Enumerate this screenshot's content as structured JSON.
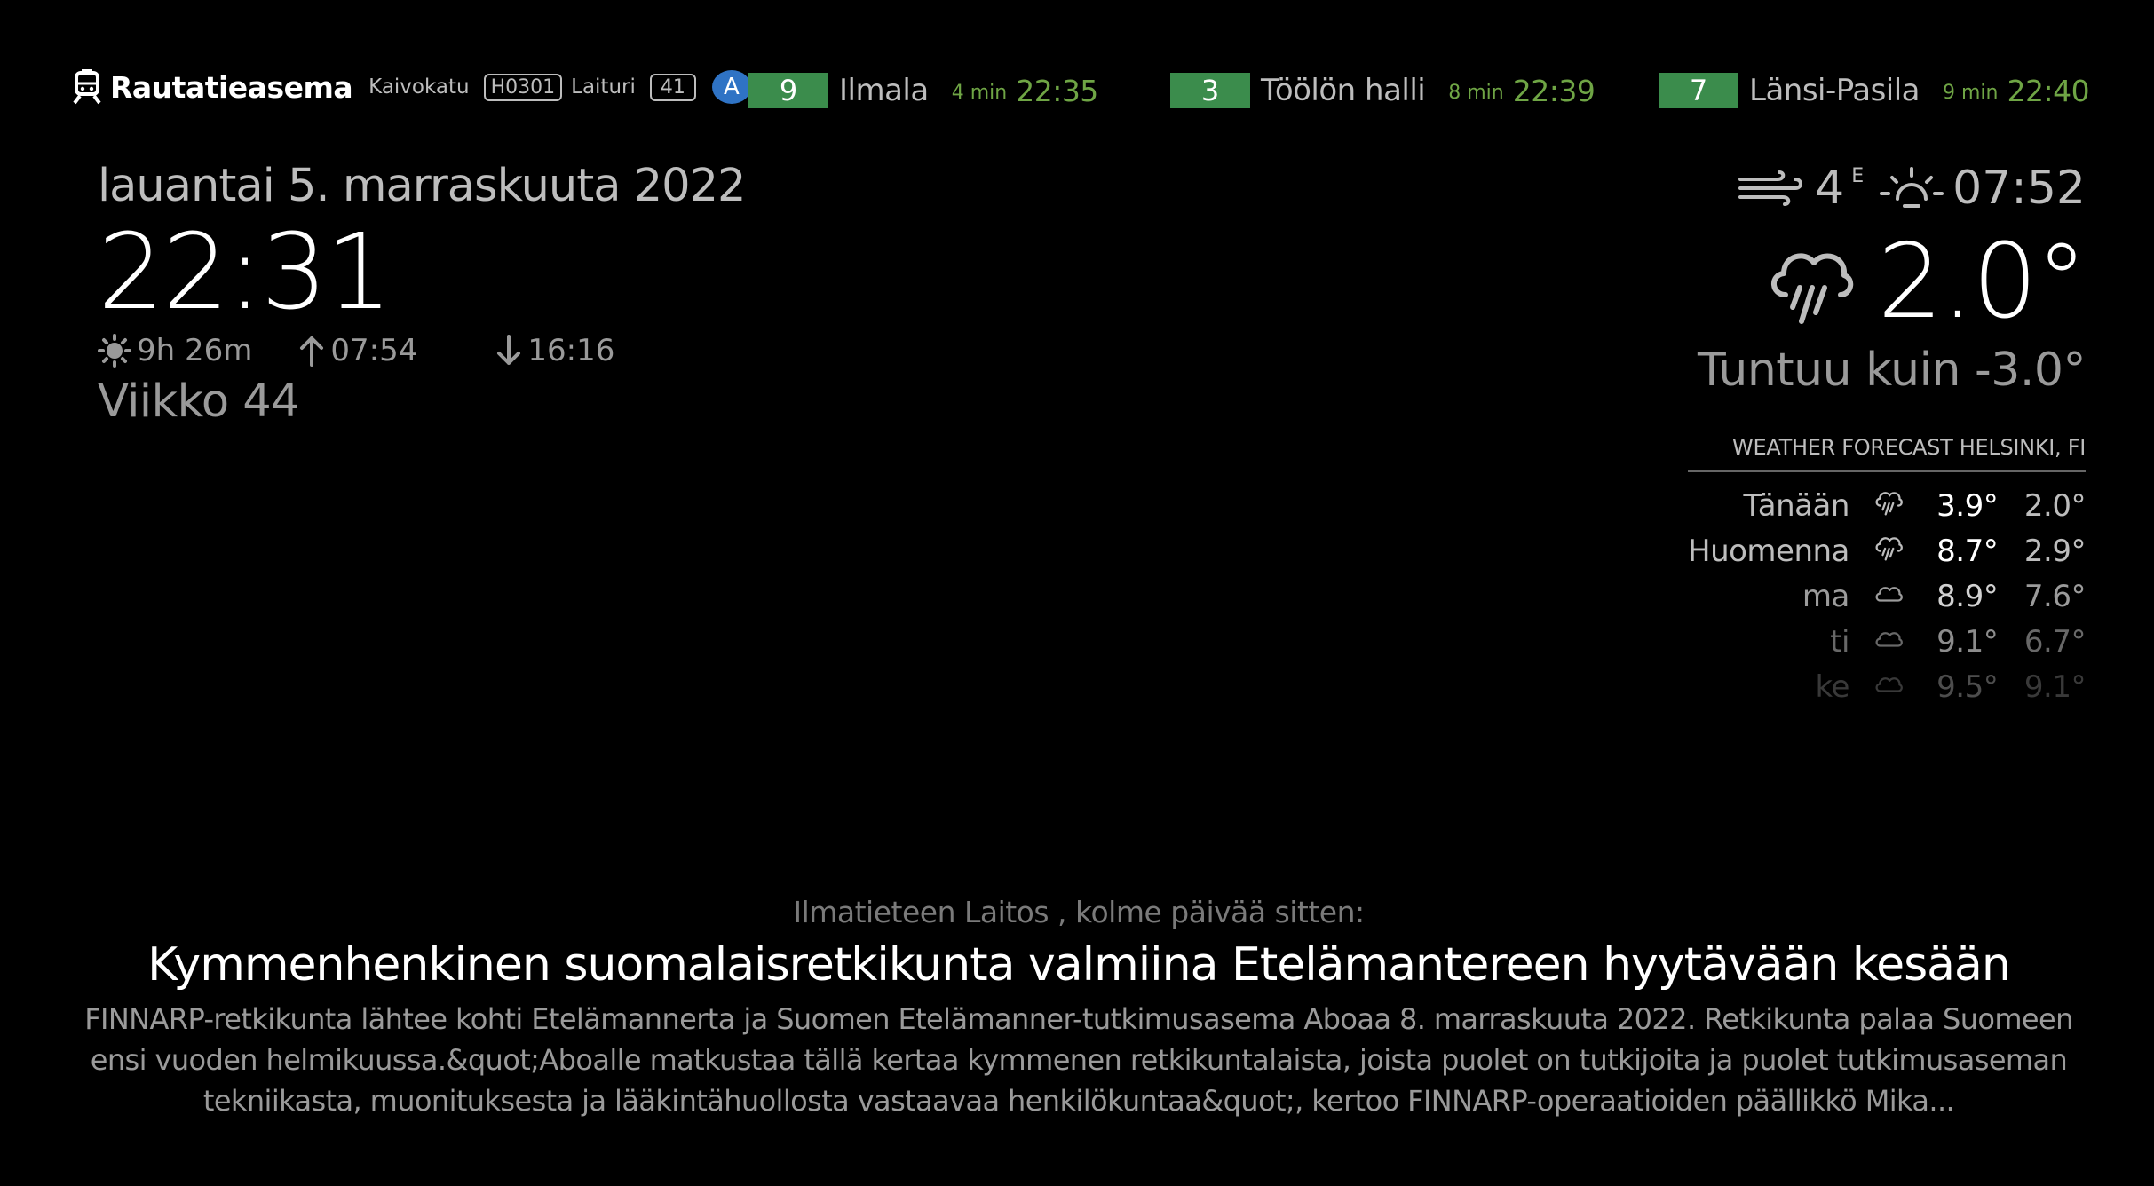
{
  "transit": {
    "station_name": "Rautatieasema",
    "stop_label": "Kaivokatu",
    "stop_code": "H0301",
    "platform_label": "Laituri",
    "platform_code": "41",
    "zone": "A",
    "departures": [
      {
        "route": "9",
        "destination": "Ilmala",
        "minutes": "4 min",
        "time": "22:35"
      },
      {
        "route": "3",
        "destination": "Töölön halli",
        "minutes": "8 min",
        "time": "22:39"
      },
      {
        "route": "7",
        "destination": "Länsi-Pasila",
        "minutes": "9 min",
        "time": "22:40"
      }
    ],
    "route_color": "#3b8c4c",
    "time_color": "#6fa545"
  },
  "clock": {
    "date": "lauantai 5. marraskuuta 2022",
    "time": "22:31",
    "daylight": "9h 26m",
    "sunrise": "07:54",
    "sunset": "16:16",
    "week": "Viikko 44"
  },
  "current_weather": {
    "wind_speed": "4",
    "wind_direction": "E",
    "next_sun_event": "07:52",
    "temperature": "2.0°",
    "feels_like": "Tuntuu kuin -3.0°",
    "icon": "rain-cloud-icon"
  },
  "forecast": {
    "header": "WEATHER FORECAST HELSINKI, FI",
    "days": [
      {
        "day": "Tänään",
        "icon": "rain-cloud-icon",
        "max": "3.9°",
        "min": "2.0°"
      },
      {
        "day": "Huomenna",
        "icon": "rain-cloud-icon",
        "max": "8.7°",
        "min": "2.9°"
      },
      {
        "day": "ma",
        "icon": "cloud-icon",
        "max": "8.9°",
        "min": "7.6°"
      },
      {
        "day": "ti",
        "icon": "cloud-icon",
        "max": "9.1°",
        "min": "6.7°"
      },
      {
        "day": "ke",
        "icon": "cloud-icon",
        "max": "9.5°",
        "min": "9.1°"
      }
    ]
  },
  "news": {
    "source": "Ilmatieteen Laitos , kolme päivää sitten:",
    "title": "Kymmenhenkinen suomalaisretkikunta valmiina Etelämantereen hyytävään kesään",
    "body": "FINNARP-retkikunta lähtee kohti Etelämannerta ja Suomen Etelämanner-tutkimusasema Aboaa 8. marraskuuta 2022. Retkikunta palaa Suomeen ensi vuoden helmikuussa.&quot;Aboalle matkustaa tällä kertaa kymmenen retkikuntalaista, joista puolet on tutkijoita ja puolet tutkimusaseman tekniikasta, muonituksesta ja lääkintähuollosta vastaavaa henkilökuntaa&quot;, kertoo FINNARP-operaatioiden päällikkö Mika..."
  }
}
